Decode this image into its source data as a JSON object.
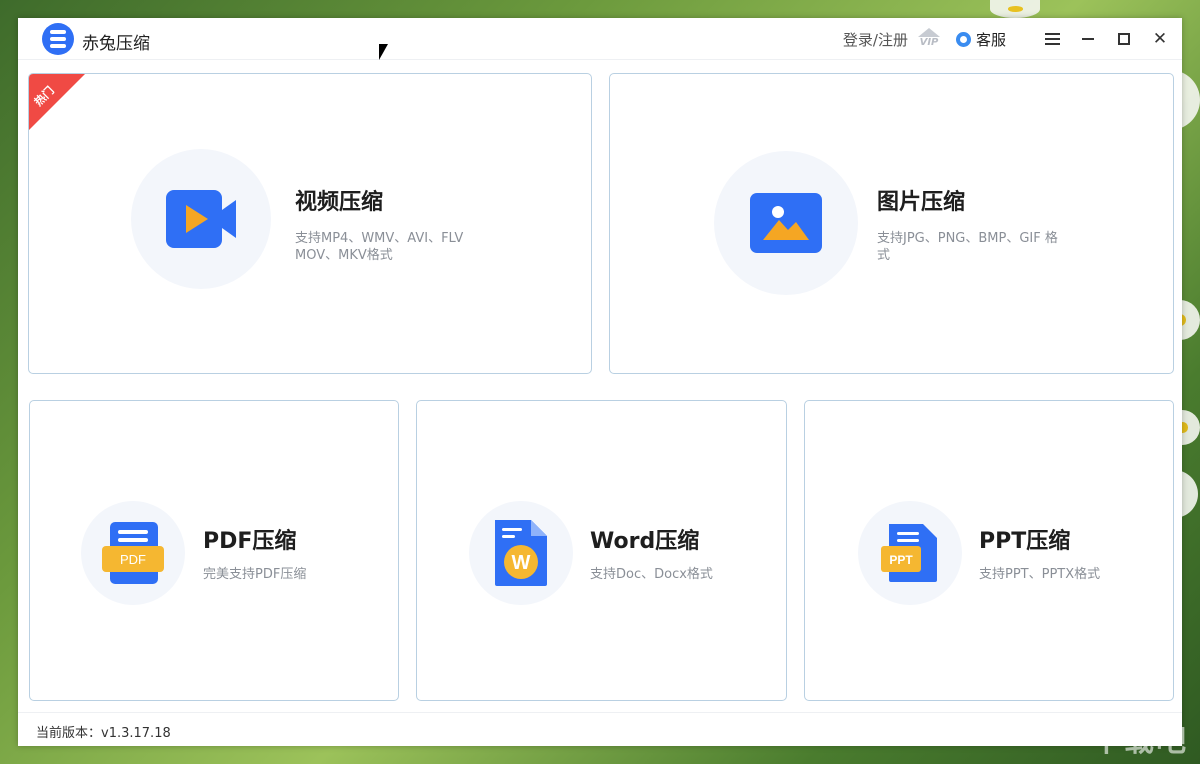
{
  "app": {
    "title": "赤兔压缩"
  },
  "titlebar": {
    "login": "登录/注册",
    "vip": "VIP",
    "customer_service": "客服"
  },
  "cards": {
    "video": {
      "title": "视频压缩",
      "desc_line1": "支持MP4、WMV、AVI、FLV",
      "desc_line2": "MOV、MKV格式",
      "badge": "热门"
    },
    "image": {
      "title": "图片压缩",
      "desc_line1": "支持JPG、PNG、BMP、GIF 格",
      "desc_line2": "式"
    },
    "pdf": {
      "title": "PDF压缩",
      "desc": "完美支持PDF压缩",
      "icon_label": "PDF"
    },
    "word": {
      "title": "Word压缩",
      "desc": "支持Doc、Docx格式",
      "icon_label": "W"
    },
    "ppt": {
      "title": "PPT压缩",
      "desc": "支持PPT、PPTX格式",
      "icon_label": "PPT"
    }
  },
  "footer": {
    "version_label": "当前版本：",
    "version": "v1.3.17.18"
  },
  "watermark": "下载吧",
  "colors": {
    "primary": "#2f6ff5",
    "accent": "#f5a623",
    "hot": "#f04a44",
    "card_border": "#b9d0e2"
  }
}
